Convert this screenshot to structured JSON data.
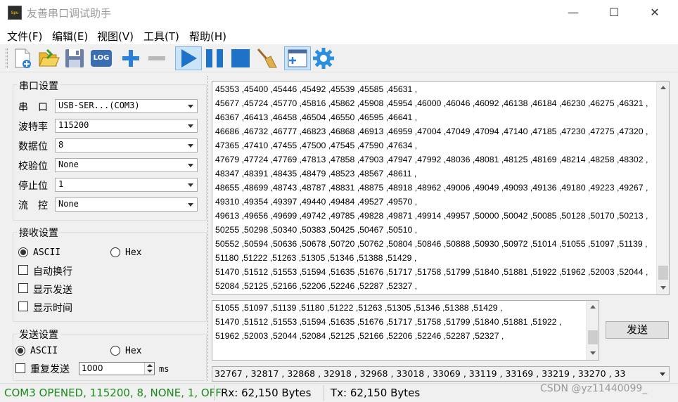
{
  "window": {
    "title": "友善串口调试助手",
    "minimize": "—",
    "maximize": "☐",
    "close": "✕"
  },
  "menu": [
    "文件(F)",
    "编辑(E)",
    "视图(V)",
    "工具(T)",
    "帮助(H)"
  ],
  "toolbar": {
    "icons": [
      "new-file-icon",
      "open-folder-icon",
      "save-icon",
      "log-icon",
      "add-icon",
      "remove-icon",
      "play-icon",
      "pause-icon",
      "stop-icon",
      "broom-icon",
      "window-plus-icon",
      "gear-icon"
    ],
    "log_label": "LOG"
  },
  "serial": {
    "title": "串口设置",
    "port_label": "串　口",
    "port_value": "USB-SER...(COM3)",
    "baud_label": "波特率",
    "baud_value": "115200",
    "data_label": "数据位",
    "data_value": "8",
    "parity_label": "校验位",
    "parity_value": "None",
    "stop_label": "停止位",
    "stop_value": "1",
    "flow_label": "流　控",
    "flow_value": "None"
  },
  "receive": {
    "title": "接收设置",
    "ascii": "ASCII",
    "hex": "Hex",
    "auto_wrap": "自动换行",
    "show_send": "显示发送",
    "show_time": "显示时间",
    "mode": "ASCII"
  },
  "send": {
    "title": "发送设置",
    "ascii": "ASCII",
    "hex": "Hex",
    "repeat_label": "重复发送",
    "interval": "1000",
    "unit": "ms",
    "button": "发送",
    "mode": "ASCII"
  },
  "receive_lines": [
    "45353 ,45400 ,45446 ,45492 ,45539 ,45585 ,45631 ,",
    "45677 ,45724 ,45770 ,45816 ,45862 ,45908 ,45954 ,46000 ,46046 ,46092 ,46138 ,46184 ,46230 ,46275 ,46321 ,",
    "46367 ,46413 ,46458 ,46504 ,46550 ,46595 ,46641 ,",
    "46686 ,46732 ,46777 ,46823 ,46868 ,46913 ,46959 ,47004 ,47049 ,47094 ,47140 ,47185 ,47230 ,47275 ,47320 ,",
    "47365 ,47410 ,47455 ,47500 ,47545 ,47590 ,47634 ,",
    "47679 ,47724 ,47769 ,47813 ,47858 ,47903 ,47947 ,47992 ,48036 ,48081 ,48125 ,48169 ,48214 ,48258 ,48302 ,",
    "48347 ,48391 ,48435 ,48479 ,48523 ,48567 ,48611 ,",
    "48655 ,48699 ,48743 ,48787 ,48831 ,48875 ,48918 ,48962 ,49006 ,49049 ,49093 ,49136 ,49180 ,49223 ,49267 ,",
    "49310 ,49354 ,49397 ,49440 ,49484 ,49527 ,49570 ,",
    "49613 ,49656 ,49699 ,49742 ,49785 ,49828 ,49871 ,49914 ,49957 ,50000 ,50042 ,50085 ,50128 ,50170 ,50213 ,",
    "50255 ,50298 ,50340 ,50383 ,50425 ,50467 ,50510 ,",
    "50552 ,50594 ,50636 ,50678 ,50720 ,50762 ,50804 ,50846 ,50888 ,50930 ,50972 ,51014 ,51055 ,51097 ,51139 ,",
    "51180 ,51222 ,51263 ,51305 ,51346 ,51388 ,51429 ,",
    "51470 ,51512 ,51553 ,51594 ,51635 ,51676 ,51717 ,51758 ,51799 ,51840 ,51881 ,51922 ,51962 ,52003 ,52044 ,",
    "52084 ,52125 ,52166 ,52206 ,52246 ,52287 ,52327 ,"
  ],
  "send_lines": [
    "51055 ,51097 ,51139 ,51180 ,51222 ,51263 ,51305 ,51346 ,51388 ,51429 ,",
    "51470 ,51512 ,51553 ,51594 ,51635 ,51676 ,51717 ,51758 ,51799 ,51840 ,51881 ,51922 ,",
    "51962 ,52003 ,52044 ,52084 ,52125 ,52166 ,52206 ,52246 ,52287 ,52327 ,"
  ],
  "history": "32767 , 32817 , 32868 , 32918 , 32968 , 33018 , 33069 , 33119 , 33169 , 33219 , 33270 , 33",
  "status": {
    "port": "COM3 OPENED, 115200, 8, NONE, 1, OFF",
    "rx": "Rx: 62,150 Bytes",
    "tx": "Tx: 62,150 Bytes",
    "watermark": "CSDN @yz11440099_"
  },
  "colors": {
    "status_green": "#1a8a1a",
    "accent_blue": "#1e73c8"
  }
}
